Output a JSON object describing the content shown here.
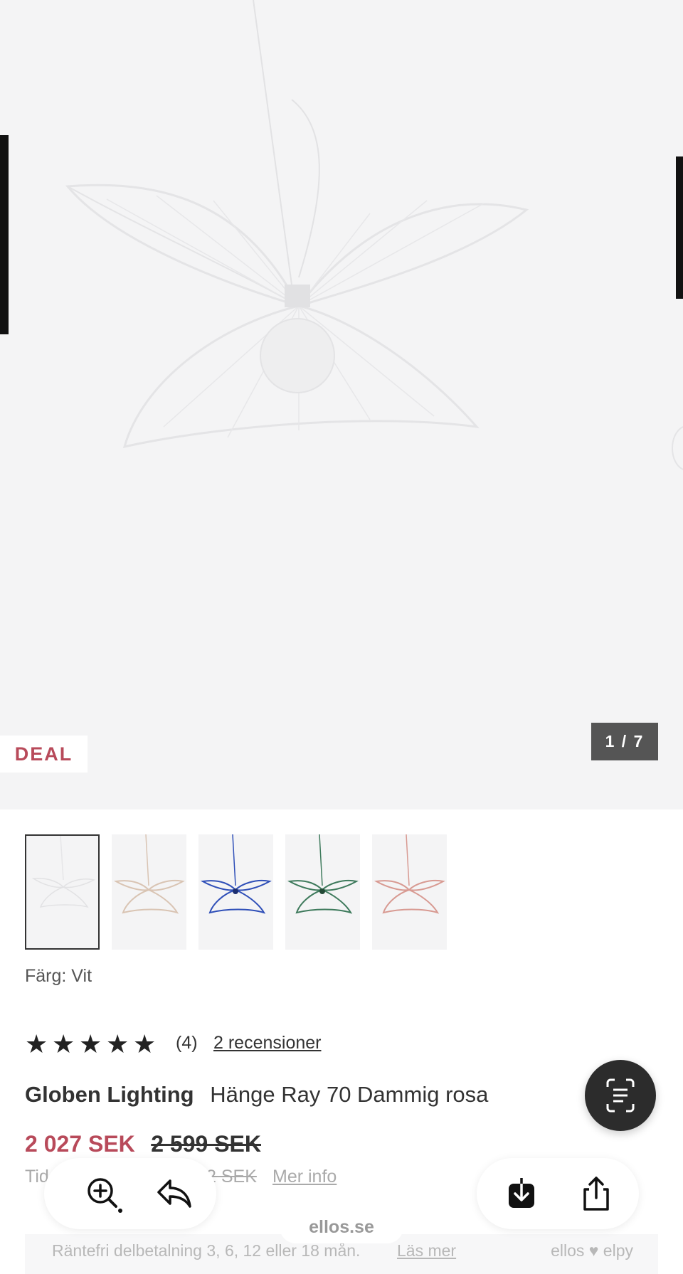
{
  "gallery": {
    "badge": "DEAL",
    "counter": "1 / 7",
    "thumbnails": [
      {
        "color": "#e6e6e8"
      },
      {
        "color": "#d9c4b3"
      },
      {
        "color": "#2f4fb8"
      },
      {
        "color": "#3e7a5c"
      },
      {
        "color": "#d89a92"
      }
    ]
  },
  "product": {
    "color_label": "Färg: Vit",
    "rating": {
      "stars": 5,
      "count": "(4)",
      "reviews_link": "2 recensioner"
    },
    "brand": "Globen Lighting",
    "name": "Hänge Ray 70 Dammig rosa",
    "price_now": "2 027 SEK",
    "price_old": "2 599 SEK",
    "lowest_prefix": "Tid",
    "lowest_suffix": "2 SEK",
    "more_info": "Mer info"
  },
  "finance": {
    "text": "Räntefri delbetalning 3, 6, 12 eller 18 mån.",
    "link": "Läs mer",
    "logo": "ellos ♥ elpy"
  },
  "browser": {
    "url": "ellos.se"
  },
  "colors": {
    "accent": "#b84a5a",
    "text": "#333333",
    "hero_bg": "#f4f4f5"
  }
}
